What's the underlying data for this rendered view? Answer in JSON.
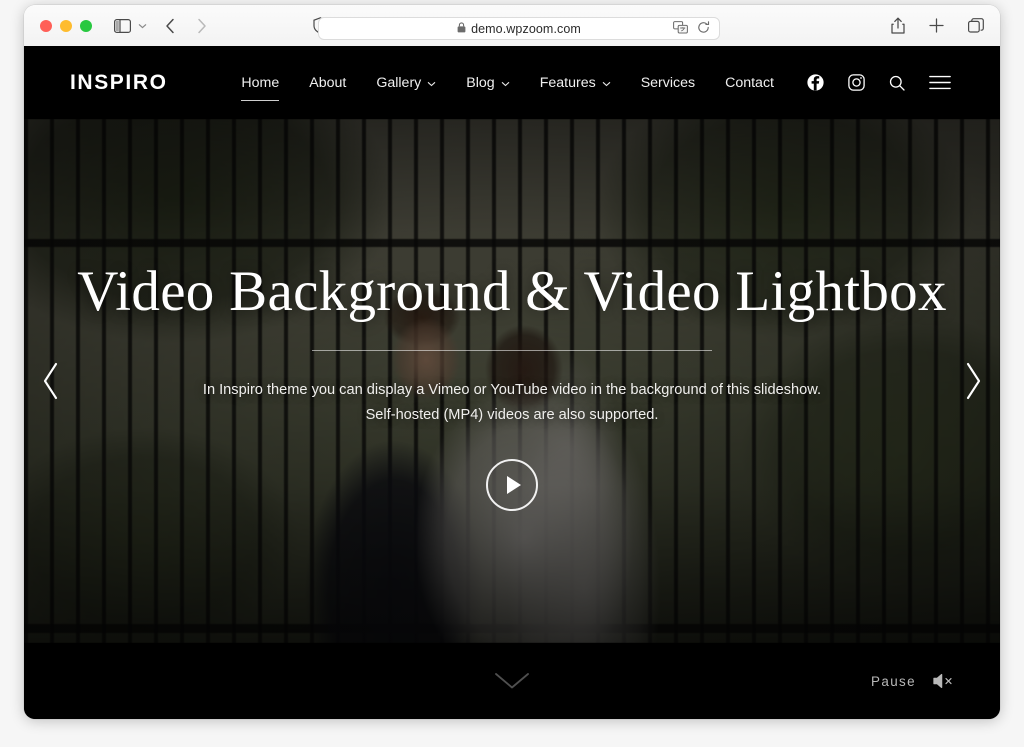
{
  "browser": {
    "url": "demo.wpzoom.com",
    "lock_icon": "lock-icon",
    "sidebar_icon": "sidebar-toggle-icon",
    "back_icon": "back-arrow-icon",
    "forward_icon": "forward-arrow-icon",
    "shield_icon": "privacy-shield-icon",
    "translate_icon": "translate-icon",
    "reload_icon": "reload-icon",
    "share_icon": "share-icon",
    "newtab_icon": "plus-new-tab-icon",
    "tabs_icon": "tab-overview-icon"
  },
  "site": {
    "logo": "INSPIRO",
    "nav": [
      {
        "label": "Home",
        "caret": "",
        "active": true
      },
      {
        "label": "About",
        "caret": "",
        "active": false
      },
      {
        "label": "Gallery",
        "caret": "⌄",
        "active": false
      },
      {
        "label": "Blog",
        "caret": "⌄",
        "active": false
      },
      {
        "label": "Features",
        "caret": "⌄",
        "active": false
      },
      {
        "label": "Services",
        "caret": "",
        "active": false
      },
      {
        "label": "Contact",
        "caret": "",
        "active": false
      }
    ],
    "nav_icons": [
      "facebook-icon",
      "instagram-icon",
      "search-icon",
      "hamburger-menu-icon"
    ]
  },
  "hero": {
    "title": "Video Background & Video Lightbox",
    "description_line1": "In Inspiro theme you can display a Vimeo or YouTube video in the background of this slideshow.",
    "description_line2": "Self-hosted (MP4) videos are also supported.",
    "play_icon": "play-button-icon",
    "prev_icon": "chevron-left-icon",
    "next_icon": "chevron-right-icon",
    "background_description": "Wedding couple in front of ornate iron fence"
  },
  "footer": {
    "scroll_icon": "chevron-down-icon",
    "pause_label": "Pause",
    "mute_icon": "speaker-muted-icon"
  },
  "colors": {
    "site_background": "#000000",
    "text_light": "#ffffff",
    "muted_text": "#b8b8b8",
    "toolbar_background": "#f6f6f6"
  }
}
